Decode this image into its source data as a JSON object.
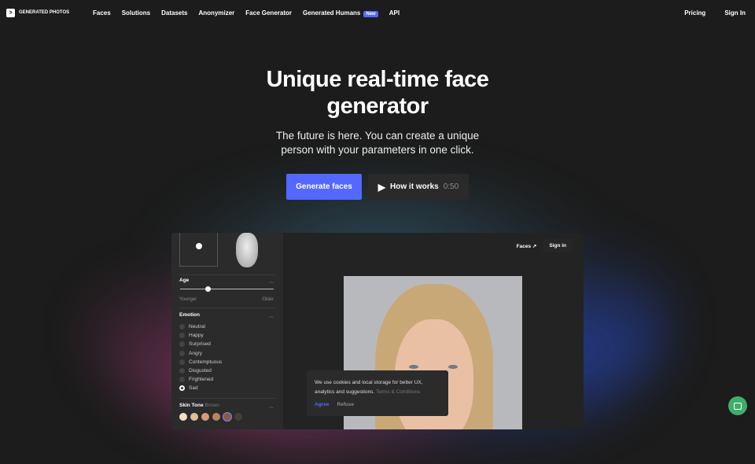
{
  "nav": {
    "brand": "GENERATED PHOTOS",
    "links": [
      "Faces",
      "Solutions",
      "Datasets",
      "Anonymizer",
      "Face Generator",
      "Generated Humans",
      "API"
    ],
    "badge": "New",
    "pricing": "Pricing",
    "signin": "Sign In"
  },
  "hero": {
    "title": "Unique real-time face generator",
    "subtitle": "The future is here. You can create a unique person with your parameters in one click.",
    "generate": "Generate faces",
    "how": "How it works",
    "duration": "0:50"
  },
  "app": {
    "faces": "Faces",
    "signin": "Sign in",
    "age": {
      "title": "Age",
      "min": "Younger",
      "max": "Older",
      "value": 0.3
    },
    "emotion": {
      "title": "Emotion",
      "options": [
        "Neutral",
        "Happy",
        "Surprised",
        "Angry",
        "Contemptuous",
        "Disgusted",
        "Frightened",
        "Sad"
      ],
      "selected": "Sad"
    },
    "skin": {
      "title": "Skin Tone",
      "value": "Brown",
      "colors": [
        "#f3dfc4",
        "#e6bc94",
        "#d69a76",
        "#b98460",
        "#8c5a3a",
        "#4a3b35"
      ]
    }
  },
  "cookie": {
    "text": "We use cookies and local storage for better UX, analytics and suggestions.",
    "terms": "Terms & Conditions",
    "agree": "Agree",
    "refuse": "Refuse"
  }
}
